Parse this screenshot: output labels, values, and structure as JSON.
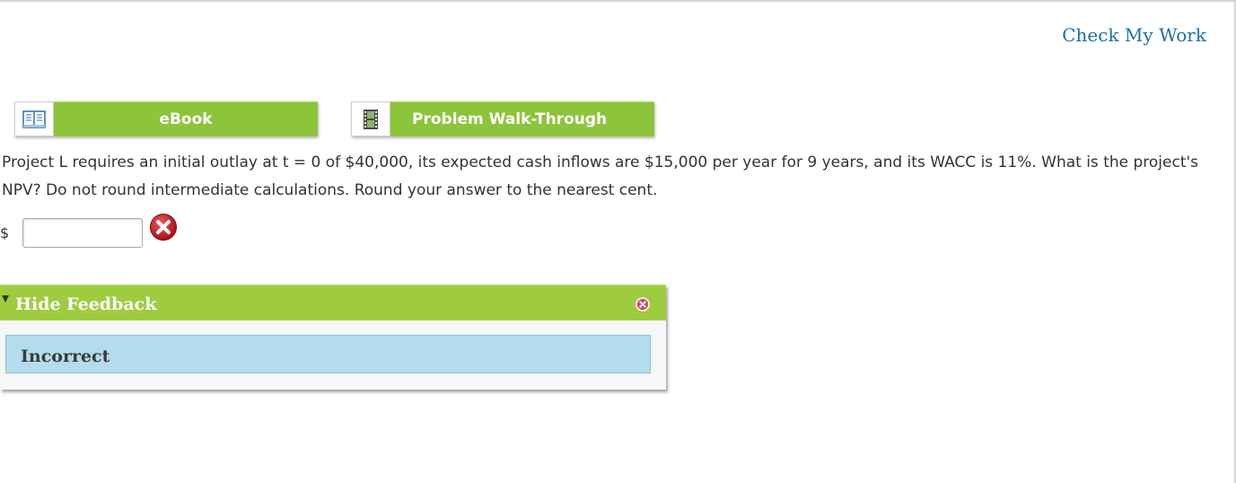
{
  "header": {
    "check_my_work": "Check My Work"
  },
  "toolbar": {
    "ebook": {
      "label": "eBook",
      "icon": "book-icon"
    },
    "walkthrough": {
      "label": "Problem Walk-Through",
      "icon": "film-icon"
    }
  },
  "question": {
    "text": "Project L requires an initial outlay at t = 0 of $40,000, its expected cash inflows are $15,000 per year for 9 years, and its WACC is 11%. What is the project's NPV? Do not round intermediate calculations. Round your answer to the nearest cent."
  },
  "answer": {
    "currency": "$",
    "value": "",
    "status_icon": "incorrect-icon"
  },
  "feedback": {
    "toggle_label": "Hide Feedback",
    "result": "Incorrect"
  },
  "colors": {
    "button_green": "#8cc43a",
    "feedback_header_green": "#9fcc3f",
    "feedback_result_blue": "#b5dcec",
    "link_blue": "#1e6ea7",
    "error_red": "#c4161c"
  }
}
